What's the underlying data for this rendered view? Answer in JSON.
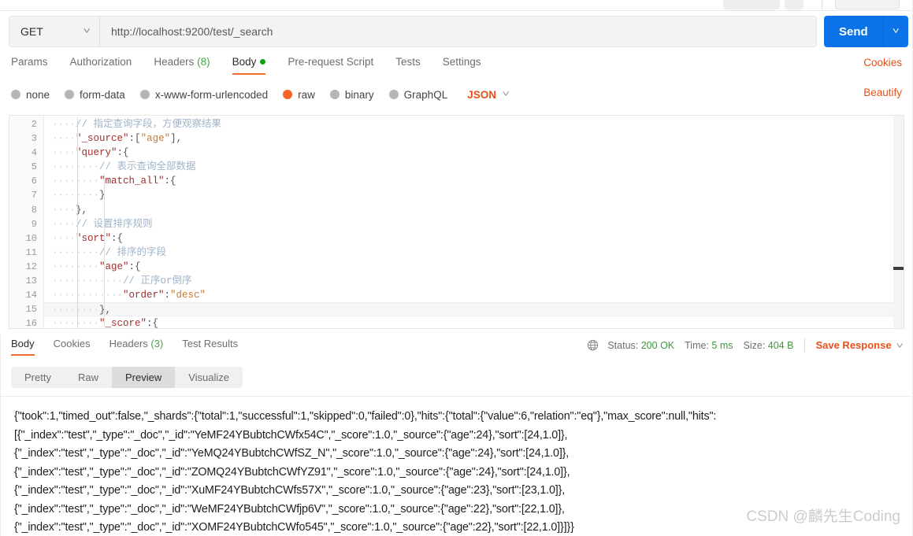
{
  "request": {
    "method": "GET",
    "url": "http://localhost:9200/test/_search",
    "send_label": "Send",
    "method_chevron": "chevron-down-icon",
    "send_chevron": "chevron-down-icon",
    "tabs": [
      {
        "label": "Params",
        "count": "",
        "active": false,
        "dot": false
      },
      {
        "label": "Authorization",
        "count": "",
        "active": false,
        "dot": false
      },
      {
        "label": "Headers",
        "count": "(8)",
        "active": false,
        "dot": false
      },
      {
        "label": "Body",
        "count": "",
        "active": true,
        "dot": true
      },
      {
        "label": "Pre-request Script",
        "count": "",
        "active": false,
        "dot": false
      },
      {
        "label": "Tests",
        "count": "",
        "active": false,
        "dot": false
      },
      {
        "label": "Settings",
        "count": "",
        "active": false,
        "dot": false
      }
    ],
    "cookies_link": "Cookies",
    "beautify_link": "Beautify",
    "body_types": [
      {
        "label": "none",
        "selected": false
      },
      {
        "label": "form-data",
        "selected": false
      },
      {
        "label": "x-www-form-urlencoded",
        "selected": false
      },
      {
        "label": "raw",
        "selected": true
      },
      {
        "label": "binary",
        "selected": false
      },
      {
        "label": "GraphQL",
        "selected": false
      }
    ],
    "raw_format": "JSON"
  },
  "editor": {
    "line_numbers": [
      "2",
      "3",
      "4",
      "5",
      "6",
      "7",
      "8",
      "9",
      "10",
      "11",
      "12",
      "13",
      "14",
      "15",
      "16"
    ],
    "lines": [
      {
        "n": "2",
        "indent": "····",
        "text": "// 指定查询字段，方便观察结果",
        "kind": "comment",
        "hl": false
      },
      {
        "n": "3",
        "indent": "····",
        "text": "\"_source\":[\"age\"],",
        "kind": "code",
        "hl": false
      },
      {
        "n": "4",
        "indent": "····",
        "text": "\"query\":{",
        "kind": "code",
        "hl": false
      },
      {
        "n": "5",
        "indent": "········",
        "text": "// 表示查询全部数据",
        "kind": "comment",
        "hl": false
      },
      {
        "n": "6",
        "indent": "········",
        "text": "\"match_all\":{",
        "kind": "code",
        "hl": false
      },
      {
        "n": "7",
        "indent": "········",
        "text": "}",
        "kind": "code",
        "hl": false
      },
      {
        "n": "8",
        "indent": "····",
        "text": "},",
        "kind": "code",
        "hl": false
      },
      {
        "n": "9",
        "indent": "····",
        "text": "// 设置排序规则",
        "kind": "comment",
        "hl": false
      },
      {
        "n": "10",
        "indent": "····",
        "text": "\"sort\":{",
        "kind": "code",
        "hl": false
      },
      {
        "n": "11",
        "indent": "········",
        "text": "// 排序的字段",
        "kind": "comment",
        "hl": false
      },
      {
        "n": "12",
        "indent": "········",
        "text": "\"age\":{",
        "kind": "code",
        "hl": false
      },
      {
        "n": "13",
        "indent": "············",
        "text": "// 正序or倒序",
        "kind": "comment",
        "hl": false
      },
      {
        "n": "14",
        "indent": "············",
        "text": "\"order\":\"desc\"",
        "kind": "code",
        "hl": false
      },
      {
        "n": "15",
        "indent": "········",
        "text": "},",
        "kind": "code",
        "hl": true
      },
      {
        "n": "16",
        "indent": "········",
        "text": "\"_score\":{",
        "kind": "code",
        "hl": false
      }
    ]
  },
  "response": {
    "tabs": [
      {
        "label": "Body",
        "count": "",
        "active": true
      },
      {
        "label": "Cookies",
        "count": "",
        "active": false
      },
      {
        "label": "Headers",
        "count": "(3)",
        "active": false
      },
      {
        "label": "Test Results",
        "count": "",
        "active": false
      }
    ],
    "globe_icon": "globe-icon",
    "status_label": "Status:",
    "status_value": "200 OK",
    "time_label": "Time:",
    "time_value": "5 ms",
    "size_label": "Size:",
    "size_value": "404 B",
    "save_response": "Save Response",
    "save_chevron": "chevron-down-icon",
    "view_modes": [
      {
        "label": "Pretty",
        "active": false
      },
      {
        "label": "Raw",
        "active": false
      },
      {
        "label": "Preview",
        "active": true
      },
      {
        "label": "Visualize",
        "active": false
      }
    ],
    "body_lines": [
      "{\"took\":1,\"timed_out\":false,\"_shards\":{\"total\":1,\"successful\":1,\"skipped\":0,\"failed\":0},\"hits\":{\"total\":{\"value\":6,\"relation\":\"eq\"},\"max_score\":null,\"hits\":",
      "[{\"_index\":\"test\",\"_type\":\"_doc\",\"_id\":\"YeMF24YBubtchCWfx54C\",\"_score\":1.0,\"_source\":{\"age\":24},\"sort\":[24,1.0]},",
      "{\"_index\":\"test\",\"_type\":\"_doc\",\"_id\":\"YeMQ24YBubtchCWfSZ_N\",\"_score\":1.0,\"_source\":{\"age\":24},\"sort\":[24,1.0]},",
      "{\"_index\":\"test\",\"_type\":\"_doc\",\"_id\":\"ZOMQ24YBubtchCWfYZ91\",\"_score\":1.0,\"_source\":{\"age\":24},\"sort\":[24,1.0]},",
      "{\"_index\":\"test\",\"_type\":\"_doc\",\"_id\":\"XuMF24YBubtchCWfs57X\",\"_score\":1.0,\"_source\":{\"age\":23},\"sort\":[23,1.0]},",
      "{\"_index\":\"test\",\"_type\":\"_doc\",\"_id\":\"WeMF24YBubtchCWfjp6V\",\"_score\":1.0,\"_source\":{\"age\":22},\"sort\":[22,1.0]},",
      "{\"_index\":\"test\",\"_type\":\"_doc\",\"_id\":\"XOMF24YBubtchCWfo545\",\"_score\":1.0,\"_source\":{\"age\":22},\"sort\":[22,1.0]}]}}"
    ]
  },
  "watermark": "CSDN @麟先生Coding",
  "colors": {
    "accent_orange": "#ef6c33",
    "link_orange": "#e8501a",
    "send_blue": "#0b72e7",
    "status_green": "#3a9b3a",
    "radio_selected": "#f26522",
    "body_dot_green": "#10a210"
  }
}
